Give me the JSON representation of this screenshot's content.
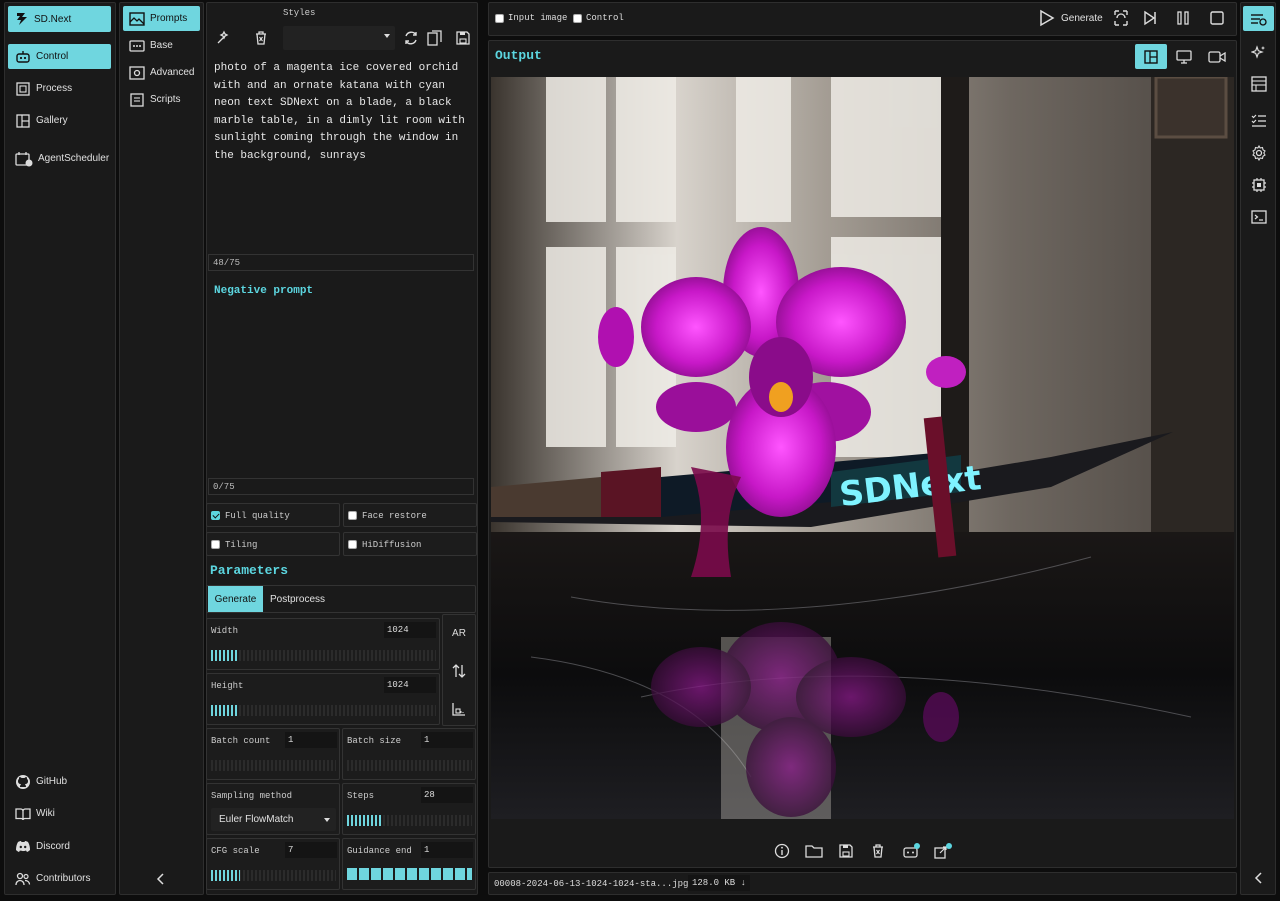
{
  "app": {
    "title": "SD.Next"
  },
  "nav": {
    "items": [
      {
        "label": "Control",
        "icon": "robot-icon"
      },
      {
        "label": "Process",
        "icon": "process-icon"
      },
      {
        "label": "Gallery",
        "icon": "gallery-icon"
      },
      {
        "label": "AgentScheduler",
        "icon": "calendar-icon"
      }
    ],
    "links": [
      {
        "label": "GitHub",
        "icon": "github-icon"
      },
      {
        "label": "Wiki",
        "icon": "book-icon"
      },
      {
        "label": "Discord",
        "icon": "discord-icon"
      },
      {
        "label": "Contributors",
        "icon": "people-icon"
      }
    ]
  },
  "subnav": {
    "items": [
      {
        "label": "Prompts"
      },
      {
        "label": "Base"
      },
      {
        "label": "Advanced"
      },
      {
        "label": "Scripts"
      }
    ]
  },
  "styles": {
    "label": "Styles",
    "selected": ""
  },
  "prompt": {
    "text": "photo of a magenta ice covered orchid with and an ornate katana with cyan neon text SDNext on a blade, a black marble table, in a dimly lit room with sunlight coming through the window in the background, sunrays",
    "tokens": "48/75"
  },
  "negative": {
    "label": "Negative prompt",
    "tokens": "0/75"
  },
  "options": {
    "full_quality": "Full quality",
    "face_restore": "Face restore",
    "tiling": "Tiling",
    "hidiffusion": "HiDiffusion"
  },
  "params": {
    "title": "Parameters",
    "tabs": [
      "Generate",
      "Postprocess"
    ],
    "width_label": "Width",
    "width": "1024",
    "width_fraction": 0.125,
    "height_label": "Height",
    "height": "1024",
    "height_fraction": 0.125,
    "ar_label": "AR",
    "batch_count_label": "Batch count",
    "batch_count": "1",
    "batch_size_label": "Batch size",
    "batch_size": "1",
    "sampler_label": "Sampling method",
    "sampler": "Euler FlowMatch",
    "steps_label": "Steps",
    "steps": "28",
    "steps_fraction": 0.28,
    "cfg_label": "CFG scale",
    "cfg": "7",
    "cfg_fraction": 0.23,
    "guidance_end_label": "Guidance end",
    "guidance_end": "1",
    "guidance_end_fraction": 1.0
  },
  "top": {
    "input_image": "Input image",
    "control": "Control",
    "generate": "Generate"
  },
  "output": {
    "title": "Output",
    "image_text": "SDNext",
    "filename": "00008-2024-06-13-1024-1024-sta...jpg",
    "filesize": "128.0 KB ↓"
  },
  "colors": {
    "accent": "#6fd6df",
    "bg": "#1a1a1a"
  }
}
